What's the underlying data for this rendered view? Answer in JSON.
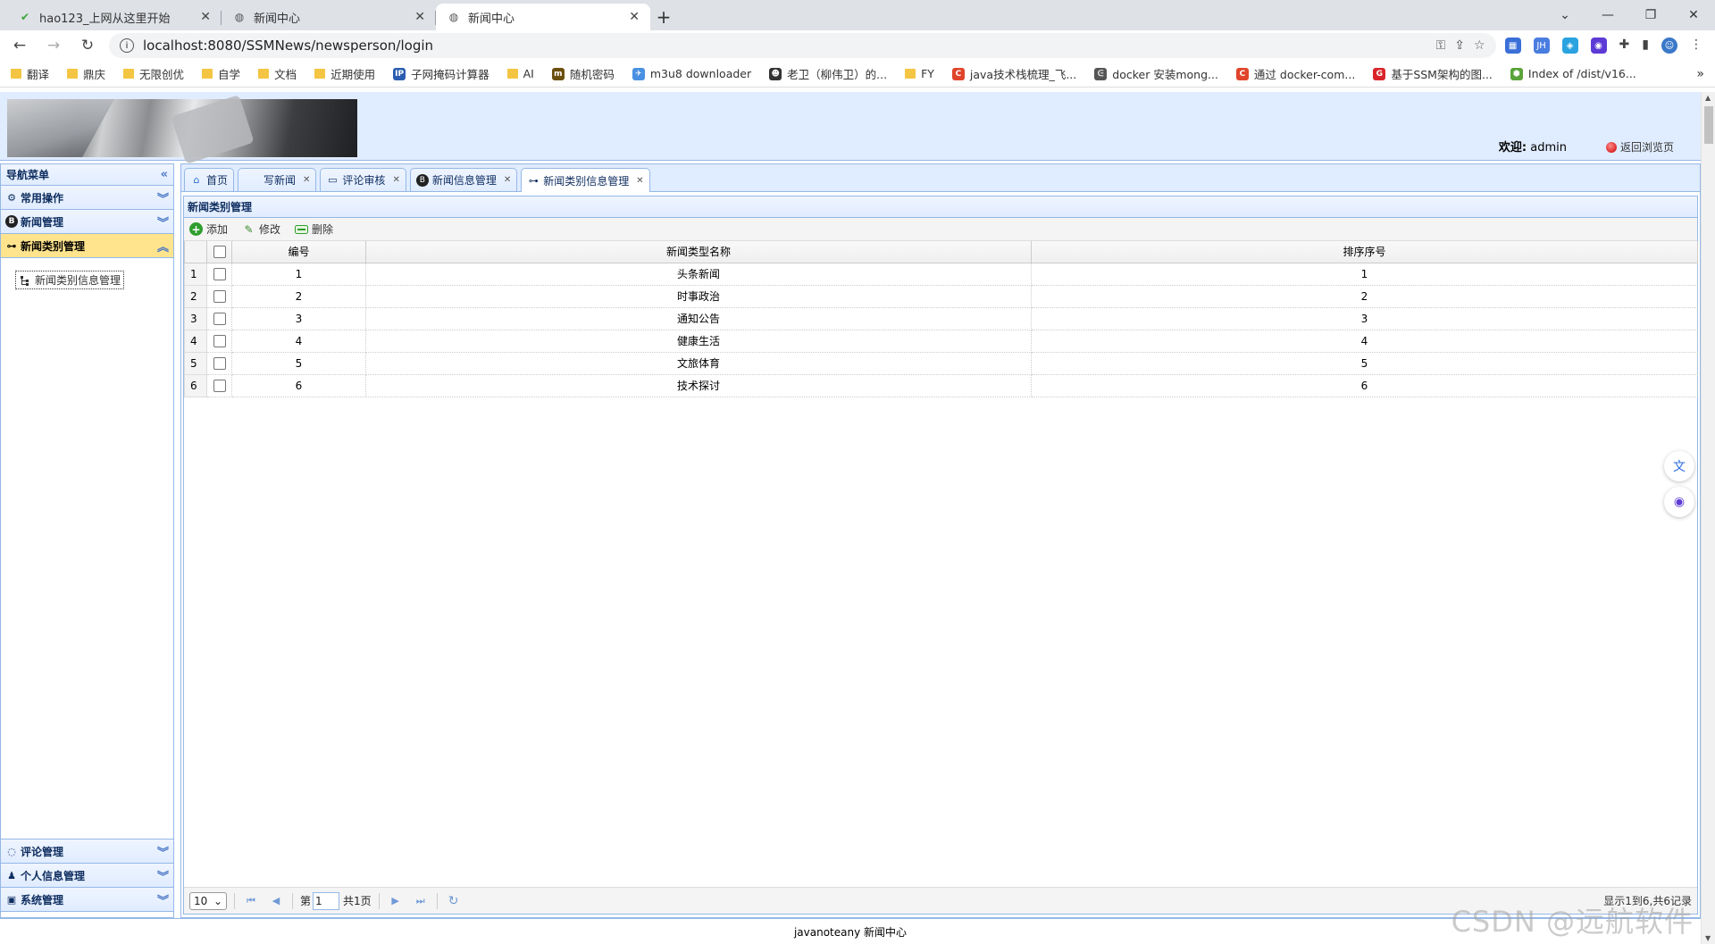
{
  "browser": {
    "tabs": [
      {
        "title": "hao123_上网从这里开始",
        "active": false,
        "icon": "hao123-icon"
      },
      {
        "title": "新闻中心",
        "active": false,
        "icon": "globe-icon"
      },
      {
        "title": "新闻中心",
        "active": true,
        "icon": "globe-icon"
      }
    ],
    "url": "localhost:8080/SSMNews/newsperson/login",
    "bookmarks": [
      {
        "label": "翻译",
        "type": "folder"
      },
      {
        "label": "鼎庆",
        "type": "folder"
      },
      {
        "label": "无限创优",
        "type": "folder"
      },
      {
        "label": "自学",
        "type": "folder"
      },
      {
        "label": "文档",
        "type": "folder"
      },
      {
        "label": "近期使用",
        "type": "folder"
      },
      {
        "label": "子网掩码计算器",
        "type": "site",
        "color": "#2a5db0",
        "glyph": "IP"
      },
      {
        "label": "AI",
        "type": "folder"
      },
      {
        "label": "随机密码",
        "type": "site",
        "color": "#6b4f10",
        "glyph": "m"
      },
      {
        "label": "m3u8 downloader",
        "type": "site",
        "color": "#4a90e2",
        "glyph": "✈"
      },
      {
        "label": "老卫（柳伟卫）的...",
        "type": "site",
        "color": "#333333",
        "glyph": "☻"
      },
      {
        "label": "FY",
        "type": "folder"
      },
      {
        "label": "java技术栈梳理_飞...",
        "type": "site",
        "color": "#e0442b",
        "glyph": "C"
      },
      {
        "label": "docker 安装mong...",
        "type": "site",
        "color": "#555555",
        "glyph": "ᕮ"
      },
      {
        "label": "通过 docker-com...",
        "type": "site",
        "color": "#e0442b",
        "glyph": "C"
      },
      {
        "label": "基于SSM架构的图...",
        "type": "site",
        "color": "#d9252a",
        "glyph": "G"
      },
      {
        "label": "Index of /dist/v16...",
        "type": "site",
        "color": "#5aa33a",
        "glyph": "⬢"
      }
    ]
  },
  "header": {
    "welcome_label": "欢迎:",
    "username": "admin",
    "back_label": "返回浏览页"
  },
  "nav": {
    "title": "导航菜单",
    "sections_top": [
      {
        "label": "常用操作",
        "icon": "gear-icon",
        "selected": false
      },
      {
        "label": "新闻管理",
        "icon": "news-b-icon",
        "selected": false
      },
      {
        "label": "新闻类别管理",
        "icon": "tree-icon",
        "selected": true
      }
    ],
    "tree_item": "新闻类别信息管理",
    "sections_bottom": [
      {
        "label": "评论管理",
        "icon": "comment-icon"
      },
      {
        "label": "个人信息管理",
        "icon": "user-icon"
      },
      {
        "label": "系统管理",
        "icon": "system-icon"
      }
    ]
  },
  "content_tabs": [
    {
      "label": "首页",
      "icon": "home-icon",
      "closable": false,
      "active": false
    },
    {
      "label": "写新闻",
      "icon": "",
      "closable": true,
      "active": false
    },
    {
      "label": "评论审核",
      "icon": "comment-review-icon",
      "closable": true,
      "active": false
    },
    {
      "label": "新闻信息管理",
      "icon": "news-b-icon",
      "closable": true,
      "active": false
    },
    {
      "label": "新闻类别信息管理",
      "icon": "tree-icon",
      "closable": true,
      "active": true
    }
  ],
  "panel": {
    "title": "新闻类别管理",
    "toolbar": {
      "add": "添加",
      "edit": "修改",
      "delete": "删除"
    },
    "columns": [
      "编号",
      "新闻类型名称",
      "排序序号"
    ],
    "rows": [
      {
        "rn": "1",
        "id": "1",
        "name": "头条新闻",
        "order": "1"
      },
      {
        "rn": "2",
        "id": "2",
        "name": "时事政治",
        "order": "2"
      },
      {
        "rn": "3",
        "id": "3",
        "name": "通知公告",
        "order": "3"
      },
      {
        "rn": "4",
        "id": "4",
        "name": "健康生活",
        "order": "4"
      },
      {
        "rn": "5",
        "id": "5",
        "name": "文旅体育",
        "order": "5"
      },
      {
        "rn": "6",
        "id": "6",
        "name": "技术探讨",
        "order": "6"
      }
    ],
    "pager": {
      "page_size": "10",
      "page_prefix": "第",
      "page_value": "1",
      "page_total": "共1页",
      "info": "显示1到6,共6记录"
    }
  },
  "footer": {
    "text": "javanoteany 新闻中心"
  },
  "watermark": "CSDN @远航软件",
  "colors": {
    "border": "#95b8e7",
    "header_bg": "#e0ecff",
    "selected_bg": "#ffe48d",
    "title_text": "#0e2d5f"
  }
}
